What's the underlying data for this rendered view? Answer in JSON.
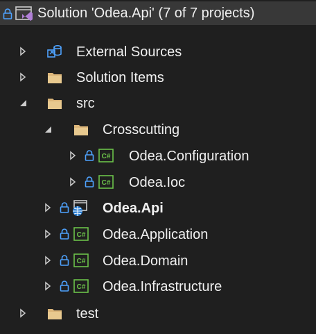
{
  "solution": {
    "label": "Solution 'Odea.Api' (7 of 7 projects)"
  },
  "items": [
    {
      "label": "External Sources"
    },
    {
      "label": "Solution Items"
    },
    {
      "label": "src"
    },
    {
      "label": "Crosscutting"
    },
    {
      "label": "Odea.Configuration"
    },
    {
      "label": "Odea.Ioc"
    },
    {
      "label": "Odea.Api"
    },
    {
      "label": "Odea.Application"
    },
    {
      "label": "Odea.Domain"
    },
    {
      "label": "Odea.Infrastructure"
    },
    {
      "label": "test"
    }
  ],
  "colors": {
    "background": "#1f1f1f",
    "selection": "#383838",
    "folder": "#dcb67a",
    "csharp": "#6cc24a",
    "lock": "#4fa3ff",
    "chevron": "#cccccc",
    "text": "#f0f0f0"
  }
}
